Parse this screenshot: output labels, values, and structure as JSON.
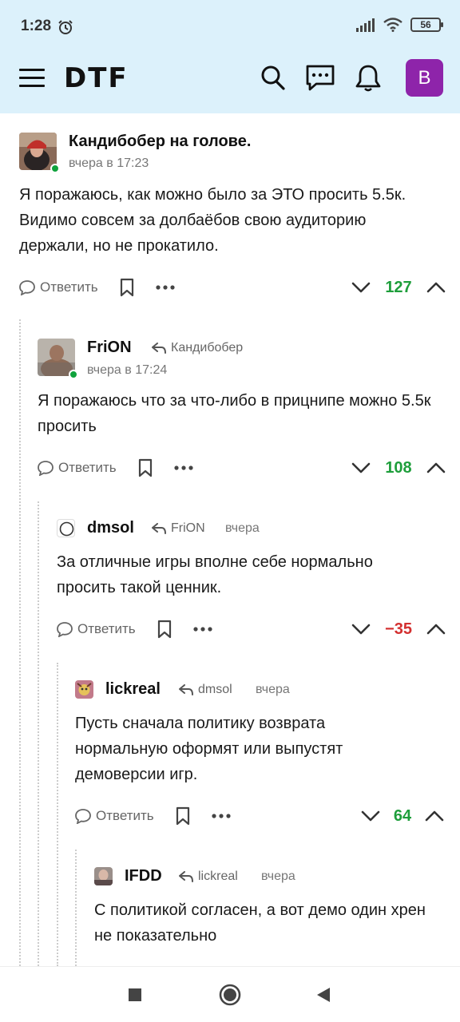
{
  "status_bar": {
    "time": "1:28",
    "battery": "56"
  },
  "app": {
    "logo": "DTF",
    "user_initial": "В"
  },
  "comments": [
    {
      "author": "Кандибобер на голове.",
      "date": "вчера в 17:23",
      "reply_to": "",
      "text": "Я поражаюсь, как можно было за ЭТО просить 5.5к. Видимо совсем за долбаёбов свою аудиторию держали, но не прокатило.",
      "reply_label": "Ответить",
      "votes": "127"
    },
    {
      "author": "FriON",
      "date": "вчера в 17:24",
      "reply_to": "Кандибобер",
      "text": "Я поражаюсь что за что-либо в прицнипе можно 5.5к  просить",
      "reply_label": "Ответить",
      "votes": "108"
    },
    {
      "author": "dmsol",
      "date": "вчера",
      "reply_to": "FriON",
      "text": "За отличные игры вполне себе нормально просить такой ценник.",
      "reply_label": "Ответить",
      "votes": "−35"
    },
    {
      "author": "lickreal",
      "date": "вчера",
      "reply_to": "dmsol",
      "text": "Пусть сначала политику возврата нормальную оформят или выпустят демоверсии игр.",
      "reply_label": "Ответить",
      "votes": "64"
    },
    {
      "author": "IFDD",
      "date": "вчера",
      "reply_to": "lickreal",
      "text": "С политикой согласен, а вот демо один хрен не показательно"
    }
  ],
  "colors": {
    "header_bg": "#dcf1fb",
    "positive": "#1e9e3b",
    "negative": "#d32f2f",
    "avatar": "#8e24aa"
  }
}
